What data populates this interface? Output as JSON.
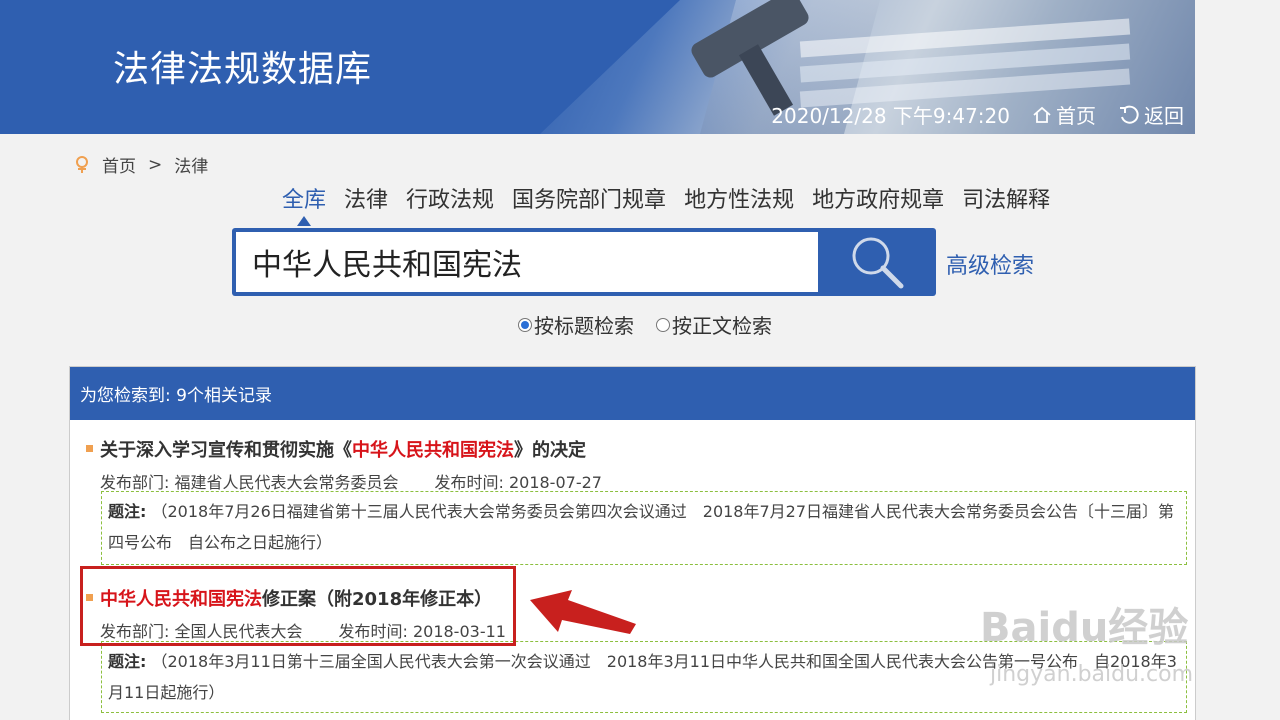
{
  "header": {
    "site_title": "法律法规数据库",
    "datetime": "2020/12/28 下午9:47:20",
    "home_label": "首页",
    "back_label": "返回"
  },
  "breadcrumb": {
    "home": "首页",
    "separator": ">",
    "current": "法律"
  },
  "tabs": [
    {
      "label": "全库",
      "active": true
    },
    {
      "label": "法律"
    },
    {
      "label": "行政法规"
    },
    {
      "label": "国务院部门规章"
    },
    {
      "label": "地方性法规"
    },
    {
      "label": "地方政府规章"
    },
    {
      "label": "司法解释"
    }
  ],
  "search": {
    "value": "中华人民共和国宪法",
    "advanced_label": "高级检索"
  },
  "search_modes": [
    {
      "label": "按标题检索",
      "checked": true
    },
    {
      "label": "按正文检索",
      "checked": false
    }
  ],
  "results": {
    "summary": "为您检索到: 9个相关记录",
    "items": [
      {
        "title_prefix": "关于深入学习宣传和贯彻实施《",
        "title_highlight": "中华人民共和国宪法",
        "title_suffix": "》的决定",
        "department": "发布部门: 福建省人民代表大会常务委员会",
        "date": "发布时间: 2018-07-27",
        "note_label": "题注:",
        "note_text": "（2018年7月26日福建省第十三届人民代表大会常务委员会第四次会议通过　2018年7月27日福建省人民代表大会常务委员会公告〔十三届〕第四号公布　自公布之日起施行）"
      },
      {
        "title_prefix": "",
        "title_highlight": "中华人民共和国宪法",
        "title_suffix": "修正案（附2018年修正本）",
        "department": "发布部门: 全国人民代表大会",
        "date": "发布时间: 2018-03-11",
        "note_label": "题注:",
        "note_text": "（2018年3月11日第十三届全国人民代表大会第一次会议通过　2018年3月11日中华人民共和国全国人民代表大会公告第一号公布　自2018年3月11日起施行）"
      }
    ]
  },
  "watermark": {
    "brand": "Baidu经验",
    "url": "jingyan.baidu.com"
  },
  "colors": {
    "primary": "#2f5fb0",
    "highlight": "#d7141a",
    "annotation": "#c8201e"
  }
}
